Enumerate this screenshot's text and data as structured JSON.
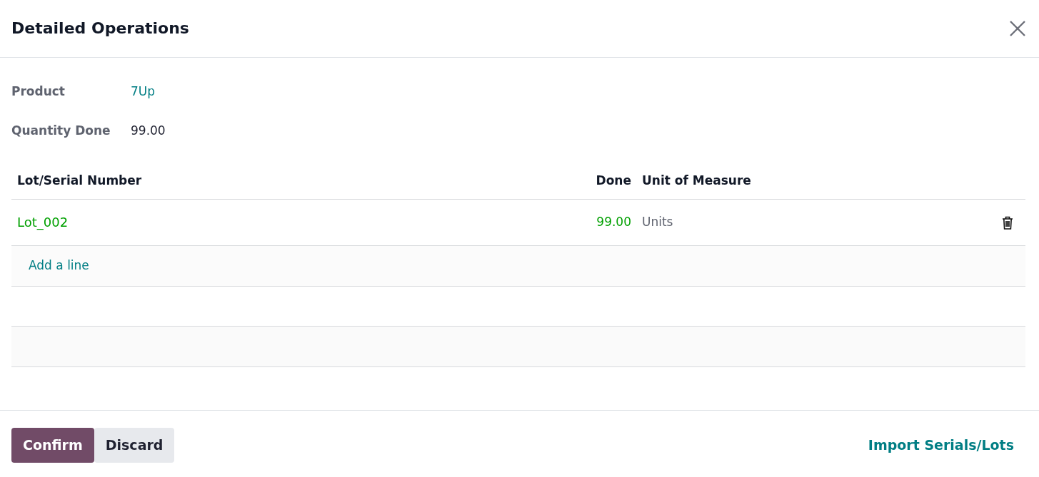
{
  "dialog": {
    "title": "Detailed Operations"
  },
  "fields": [
    {
      "label": "Product",
      "value": "7Up",
      "kind": "link"
    },
    {
      "label": "Quantity Done",
      "value": "99.00",
      "kind": "text"
    }
  ],
  "table": {
    "columns": [
      "Lot/Serial Number",
      "Done",
      "Unit of Measure"
    ],
    "rows": [
      {
        "lot": "Lot_002",
        "done": "99.00",
        "uom": "Units"
      }
    ],
    "add_line": "Add a line"
  },
  "footer": {
    "buttons": [
      {
        "label": "Confirm",
        "kind": "primary"
      },
      {
        "label": "Discard",
        "kind": "secondary"
      }
    ],
    "link": "Import Serials/Lots"
  }
}
